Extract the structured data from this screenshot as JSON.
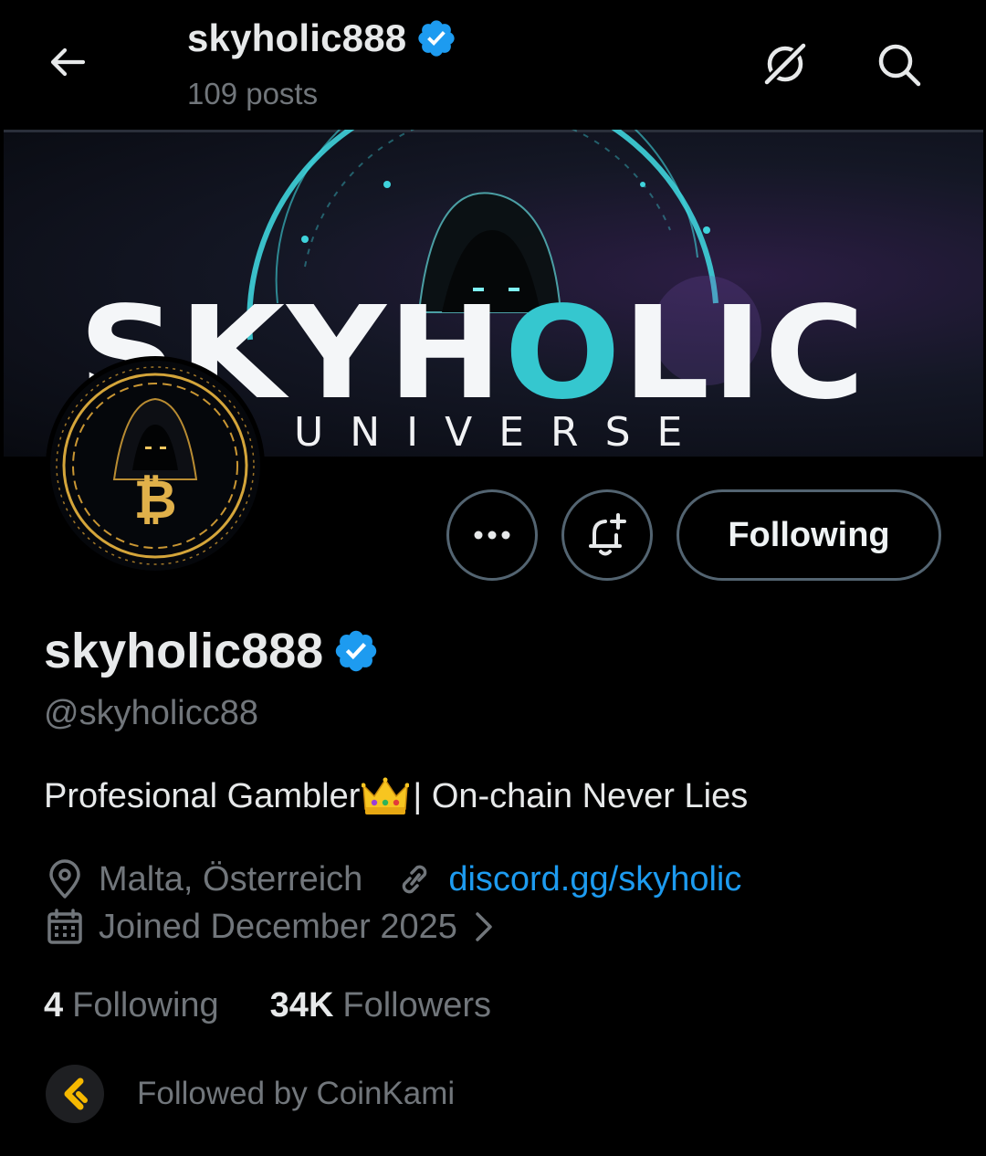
{
  "header": {
    "title": "skyholic888",
    "post_count": "109 posts"
  },
  "banner": {
    "word_part1": "SKYH",
    "word_o": "O",
    "word_part2": "LIC",
    "subtitle": "UNIVERSE"
  },
  "actions": {
    "follow_label": "Following"
  },
  "profile": {
    "display_name": "skyholic888",
    "handle": "@skyholicc88",
    "bio_before": "Profesional Gambler",
    "bio_after": " | On-chain Never Lies",
    "location": "Malta, Österreich",
    "link": "discord.gg/skyholic",
    "joined": "Joined December 2025"
  },
  "stats": {
    "following_count": "4",
    "following_label": "Following",
    "followers_count": "34K",
    "followers_label": "Followers"
  },
  "followed_by": {
    "text": "Followed by CoinKami"
  },
  "icons": {
    "back": "arrow-left-icon",
    "grok": "grok-icon",
    "search": "search-icon",
    "verified": "verified-badge-icon",
    "more": "more-horizontal-icon",
    "notify": "bell-plus-icon",
    "location": "location-pin-icon",
    "link": "link-icon",
    "calendar": "calendar-icon",
    "chevron": "chevron-right-icon",
    "crown": "crown-emoji"
  },
  "colors": {
    "background": "#000000",
    "text_primary": "#e7e9ea",
    "text_secondary": "#71767b",
    "link": "#1d9bf0",
    "verified": "#1d9bf0",
    "button_border": "#536471",
    "banner_accent": "#35c7cf",
    "avatar_gold": "#d4a53a"
  }
}
